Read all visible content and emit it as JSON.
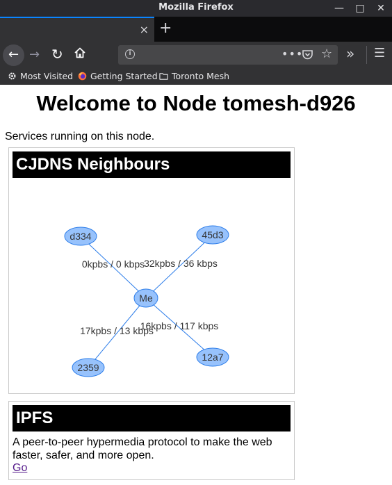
{
  "browser": {
    "window_title": "Mozilla Firefox",
    "new_tab_symbol": "+",
    "tab_close_symbol": "×",
    "window_controls": {
      "minimize": "—",
      "maximize": "□",
      "close": "✕"
    },
    "url_value": "",
    "bookmarks": [
      {
        "label": "Most Visited",
        "icon": "gear-icon"
      },
      {
        "label": "Getting Started",
        "icon": "firefox-icon"
      },
      {
        "label": "Toronto Mesh",
        "icon": "folder-icon"
      }
    ]
  },
  "page": {
    "heading": "Welcome to Node tomesh-d926",
    "intro": "Services running on this node.",
    "cjdns": {
      "title": "CJDNS Neighbours",
      "center_node": "Me",
      "neighbours": [
        {
          "name": "d334",
          "rate": "0kpbs / 0 kbps"
        },
        {
          "name": "45d3",
          "rate": "32kpbs / 36 kbps"
        },
        {
          "name": "2359",
          "rate": "17kpbs / 13 kbps"
        },
        {
          "name": "12a7",
          "rate": "16kpbs / 117 kbps"
        }
      ]
    },
    "ipfs": {
      "title": "IPFS",
      "description": "A peer-to-peer hypermedia protocol to make the web faster, safer, and more open.",
      "link_label": "Go"
    }
  },
  "colors": {
    "node_fill": "#97c2fc",
    "node_border": "#2b7ce9",
    "edge": "#2b7ce9",
    "chrome_dark": "#323234",
    "tab_accent": "#0a84ff",
    "link": "#551a8b"
  }
}
